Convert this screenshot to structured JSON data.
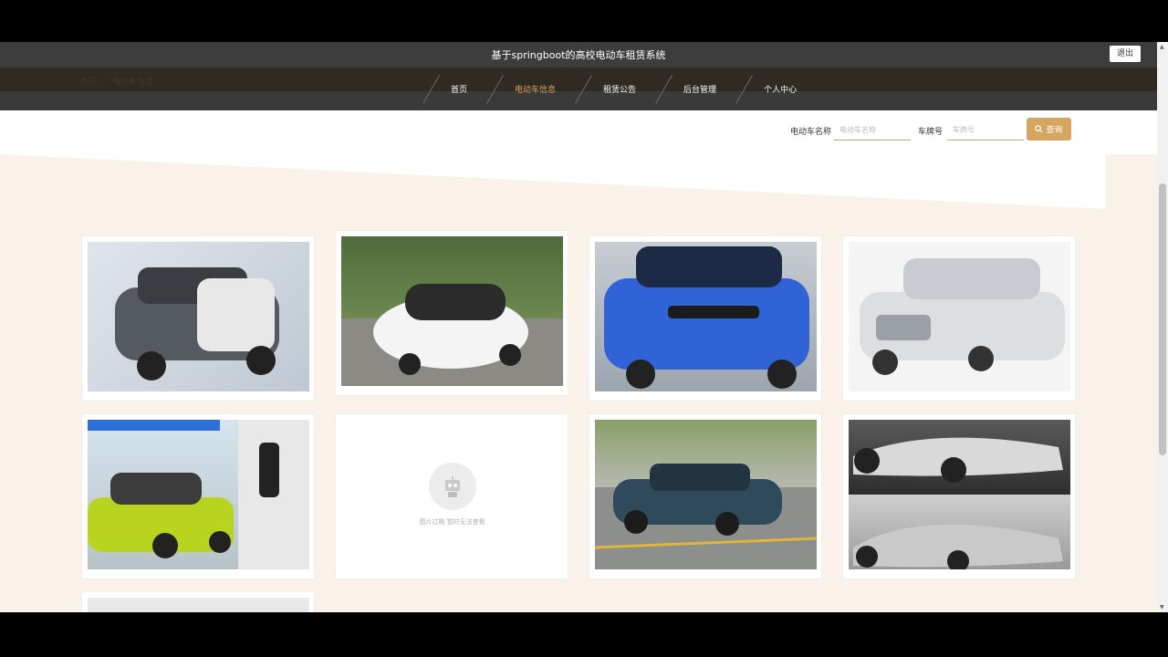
{
  "header": {
    "title": "基于springboot的高校电动车租赁系统",
    "logout_label": "退出"
  },
  "breadcrumb": {
    "home": "首页",
    "separator": "/",
    "current": "电动车信息"
  },
  "nav": {
    "items": [
      {
        "label": "首页"
      },
      {
        "label": "电动车信息"
      },
      {
        "label": "租赁公告"
      },
      {
        "label": "后台管理"
      },
      {
        "label": "个人中心"
      }
    ],
    "active_color": "#d9a25f"
  },
  "search": {
    "name_label": "电动车名称",
    "name_placeholder": "电动车名称",
    "plate_label": "车牌号",
    "plate_placeholder": "车牌号",
    "button_label": "查询",
    "button_color": "#d6a560"
  },
  "cards": [
    {
      "image": "car-photo",
      "icon": "car-photo-icon"
    },
    {
      "image": "car-photo",
      "icon": "car-photo-icon"
    },
    {
      "image": "car-photo",
      "icon": "car-photo-icon"
    },
    {
      "image": "car-photo",
      "icon": "car-photo-icon"
    },
    {
      "image": "car-photo",
      "icon": "car-photo-icon"
    },
    {
      "image": "broken-image",
      "placeholder_text": "图片过期 暂时无法查看",
      "icon": "robot-icon"
    },
    {
      "image": "car-photo",
      "icon": "car-photo-icon"
    },
    {
      "image": "car-photo",
      "icon": "car-photo-icon"
    },
    {
      "image": "car-photo",
      "icon": "car-photo-icon"
    }
  ]
}
